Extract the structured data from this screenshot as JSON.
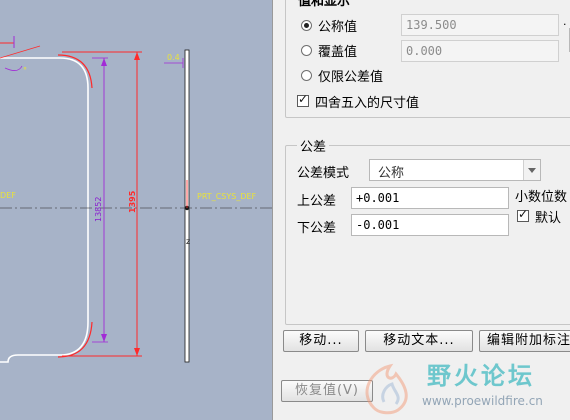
{
  "viewport": {
    "csys_label_left": "DEF",
    "csys_label_right": "PRT_CSYS_DEF",
    "dim_outer": "1395",
    "dim_inner": "13852",
    "dim_small": "0.4",
    "dim_corner": "°",
    "colors": {
      "background": "#a7b3c8",
      "outline": "#ffffff",
      "dimension_red": "#ff2a2a",
      "dimension_purple": "#a22bd6",
      "dim_text_purple": "#8a1fd0",
      "csys_yellow": "#e9e23a",
      "edge_dark": "#1a1a1a"
    }
  },
  "display_group": {
    "title": "值和显示",
    "options": [
      {
        "label": "公称值",
        "value": "139.500",
        "selected": true
      },
      {
        "label": "覆盖值",
        "value": "0.000",
        "selected": false
      },
      {
        "label": "仅限公差值",
        "selected": false
      }
    ],
    "round_checkbox": {
      "label": "四舍五入的尺寸值",
      "checked": true
    }
  },
  "tolerance_group": {
    "title": "公差",
    "mode_label": "公差模式",
    "mode_value": "公称",
    "upper_label": "上公差",
    "upper_value": "+0.001",
    "lower_label": "下公差",
    "lower_value": "-0.001",
    "decimal_label": "小数位数",
    "default_checkbox": {
      "label": "默认",
      "checked": true
    }
  },
  "buttons": {
    "move": "移动...",
    "move_text": "移动文本...",
    "edit_attach": "编辑附加标注",
    "restore": "恢复值(V)"
  },
  "watermark": {
    "text": "野火论坛",
    "url": "www.proewildfire.cn"
  }
}
